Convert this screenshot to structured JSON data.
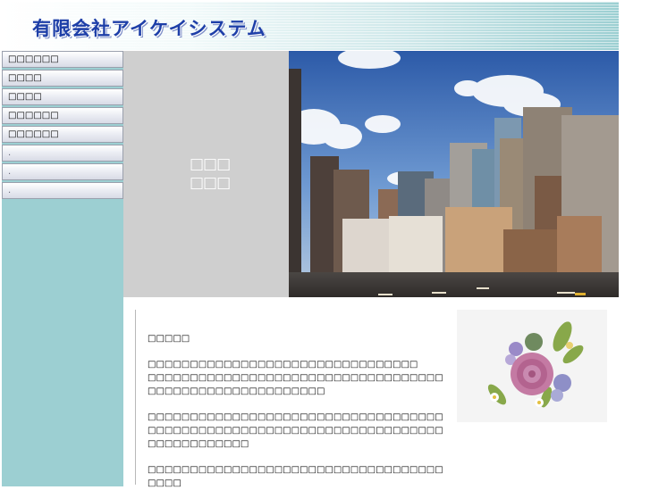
{
  "header": {
    "logo_text": "有限会社アイケイシステム"
  },
  "sidebar": {
    "menu_items": [
      {
        "label": "□□□□□□"
      },
      {
        "label": "□□□□"
      },
      {
        "label": "□□□□"
      },
      {
        "label": "□□□□□□"
      },
      {
        "label": "□□□□□□"
      },
      {
        "label": "."
      },
      {
        "label": "."
      },
      {
        "label": "."
      }
    ]
  },
  "hero": {
    "caption_line1": "□□□",
    "caption_line2": "□□□"
  },
  "content": {
    "heading": "□□□□□",
    "para1_line1": "□□□□□□□□□□□□□□□□□□□□□□□□□□□□□□□□",
    "para1_line2": "□□□□□□□□□□□□□□□□□□□□□□□□□□□□□□□□□□□□□□□□□□□□□□□□□□□□□□□□",
    "para2": "□□□□□□□□□□□□□□□□□□□□□□□□□□□□□□□□□□□□□□□□□□□□□□□□□□□□□□□□□□□□□□□□□□□□□□□□□□□□□□□□□□",
    "para3": "□□□□□□□□□□□□□□□□□□□□□□□□□□□□□□□□□□□□□□□"
  },
  "colors": {
    "sidebar_bg": "#9ccfd2",
    "logo_text": "#1e3fa8",
    "photo_panel_bg": "#cfcfcf"
  }
}
